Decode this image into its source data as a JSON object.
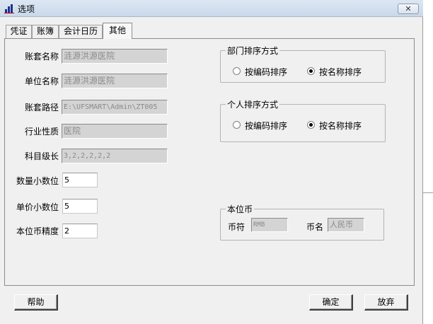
{
  "window": {
    "title": "选项",
    "close_glyph": "✕"
  },
  "tabs": [
    {
      "label": "凭证"
    },
    {
      "label": "账簿"
    },
    {
      "label": "会计日历"
    },
    {
      "label": "其他"
    }
  ],
  "fields": {
    "account_set_name": {
      "label": "账套名称",
      "value": "涟源洪源医院"
    },
    "unit_name": {
      "label": "单位名称",
      "value": "涟源洪源医院"
    },
    "account_set_path": {
      "label": "账套路径",
      "value": "E:\\UFSMART\\Admin\\ZT005"
    },
    "industry": {
      "label": "行业性质",
      "value": "医院"
    },
    "subject_levels": {
      "label": "科目级长",
      "value": "3,2,2,2,2,2"
    },
    "qty_decimals": {
      "label": "数量小数位",
      "value": "5"
    },
    "price_decimals": {
      "label": "单价小数位",
      "value": "5"
    },
    "currency_precision": {
      "label": "本位币精度",
      "value": "2"
    }
  },
  "dept_sort": {
    "title": "部门排序方式",
    "by_code": "按编码排序",
    "by_name": "按名称排序",
    "selected": "by_name"
  },
  "person_sort": {
    "title": "个人排序方式",
    "by_code": "按编码排序",
    "by_name": "按名称排序",
    "selected": "by_name"
  },
  "base_currency": {
    "title": "本位币",
    "symbol_label": "币符",
    "symbol_value": "RMB",
    "name_label": "币名",
    "name_value": "人民币"
  },
  "buttons": {
    "help": "帮助",
    "ok": "确定",
    "cancel": "放弃"
  },
  "colors": {
    "title_bar": "#c9d8ea",
    "dialog_bg": "#f0f0f0",
    "readonly_bg": "#d4d4d4",
    "readonly_text": "#8a8a8a"
  }
}
